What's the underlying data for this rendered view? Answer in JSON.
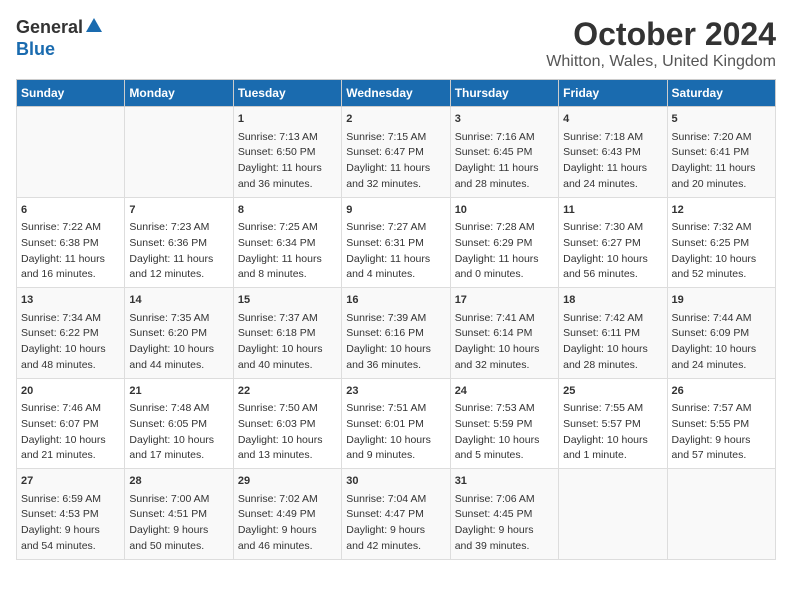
{
  "logo": {
    "general": "General",
    "blue": "Blue"
  },
  "title": {
    "month": "October 2024",
    "location": "Whitton, Wales, United Kingdom"
  },
  "days_of_week": [
    "Sunday",
    "Monday",
    "Tuesday",
    "Wednesday",
    "Thursday",
    "Friday",
    "Saturday"
  ],
  "weeks": [
    [
      {
        "day": "",
        "content": ""
      },
      {
        "day": "",
        "content": ""
      },
      {
        "day": "1",
        "content": "Sunrise: 7:13 AM\nSunset: 6:50 PM\nDaylight: 11 hours\nand 36 minutes."
      },
      {
        "day": "2",
        "content": "Sunrise: 7:15 AM\nSunset: 6:47 PM\nDaylight: 11 hours\nand 32 minutes."
      },
      {
        "day": "3",
        "content": "Sunrise: 7:16 AM\nSunset: 6:45 PM\nDaylight: 11 hours\nand 28 minutes."
      },
      {
        "day": "4",
        "content": "Sunrise: 7:18 AM\nSunset: 6:43 PM\nDaylight: 11 hours\nand 24 minutes."
      },
      {
        "day": "5",
        "content": "Sunrise: 7:20 AM\nSunset: 6:41 PM\nDaylight: 11 hours\nand 20 minutes."
      }
    ],
    [
      {
        "day": "6",
        "content": "Sunrise: 7:22 AM\nSunset: 6:38 PM\nDaylight: 11 hours\nand 16 minutes."
      },
      {
        "day": "7",
        "content": "Sunrise: 7:23 AM\nSunset: 6:36 PM\nDaylight: 11 hours\nand 12 minutes."
      },
      {
        "day": "8",
        "content": "Sunrise: 7:25 AM\nSunset: 6:34 PM\nDaylight: 11 hours\nand 8 minutes."
      },
      {
        "day": "9",
        "content": "Sunrise: 7:27 AM\nSunset: 6:31 PM\nDaylight: 11 hours\nand 4 minutes."
      },
      {
        "day": "10",
        "content": "Sunrise: 7:28 AM\nSunset: 6:29 PM\nDaylight: 11 hours\nand 0 minutes."
      },
      {
        "day": "11",
        "content": "Sunrise: 7:30 AM\nSunset: 6:27 PM\nDaylight: 10 hours\nand 56 minutes."
      },
      {
        "day": "12",
        "content": "Sunrise: 7:32 AM\nSunset: 6:25 PM\nDaylight: 10 hours\nand 52 minutes."
      }
    ],
    [
      {
        "day": "13",
        "content": "Sunrise: 7:34 AM\nSunset: 6:22 PM\nDaylight: 10 hours\nand 48 minutes."
      },
      {
        "day": "14",
        "content": "Sunrise: 7:35 AM\nSunset: 6:20 PM\nDaylight: 10 hours\nand 44 minutes."
      },
      {
        "day": "15",
        "content": "Sunrise: 7:37 AM\nSunset: 6:18 PM\nDaylight: 10 hours\nand 40 minutes."
      },
      {
        "day": "16",
        "content": "Sunrise: 7:39 AM\nSunset: 6:16 PM\nDaylight: 10 hours\nand 36 minutes."
      },
      {
        "day": "17",
        "content": "Sunrise: 7:41 AM\nSunset: 6:14 PM\nDaylight: 10 hours\nand 32 minutes."
      },
      {
        "day": "18",
        "content": "Sunrise: 7:42 AM\nSunset: 6:11 PM\nDaylight: 10 hours\nand 28 minutes."
      },
      {
        "day": "19",
        "content": "Sunrise: 7:44 AM\nSunset: 6:09 PM\nDaylight: 10 hours\nand 24 minutes."
      }
    ],
    [
      {
        "day": "20",
        "content": "Sunrise: 7:46 AM\nSunset: 6:07 PM\nDaylight: 10 hours\nand 21 minutes."
      },
      {
        "day": "21",
        "content": "Sunrise: 7:48 AM\nSunset: 6:05 PM\nDaylight: 10 hours\nand 17 minutes."
      },
      {
        "day": "22",
        "content": "Sunrise: 7:50 AM\nSunset: 6:03 PM\nDaylight: 10 hours\nand 13 minutes."
      },
      {
        "day": "23",
        "content": "Sunrise: 7:51 AM\nSunset: 6:01 PM\nDaylight: 10 hours\nand 9 minutes."
      },
      {
        "day": "24",
        "content": "Sunrise: 7:53 AM\nSunset: 5:59 PM\nDaylight: 10 hours\nand 5 minutes."
      },
      {
        "day": "25",
        "content": "Sunrise: 7:55 AM\nSunset: 5:57 PM\nDaylight: 10 hours\nand 1 minute."
      },
      {
        "day": "26",
        "content": "Sunrise: 7:57 AM\nSunset: 5:55 PM\nDaylight: 9 hours\nand 57 minutes."
      }
    ],
    [
      {
        "day": "27",
        "content": "Sunrise: 6:59 AM\nSunset: 4:53 PM\nDaylight: 9 hours\nand 54 minutes."
      },
      {
        "day": "28",
        "content": "Sunrise: 7:00 AM\nSunset: 4:51 PM\nDaylight: 9 hours\nand 50 minutes."
      },
      {
        "day": "29",
        "content": "Sunrise: 7:02 AM\nSunset: 4:49 PM\nDaylight: 9 hours\nand 46 minutes."
      },
      {
        "day": "30",
        "content": "Sunrise: 7:04 AM\nSunset: 4:47 PM\nDaylight: 9 hours\nand 42 minutes."
      },
      {
        "day": "31",
        "content": "Sunrise: 7:06 AM\nSunset: 4:45 PM\nDaylight: 9 hours\nand 39 minutes."
      },
      {
        "day": "",
        "content": ""
      },
      {
        "day": "",
        "content": ""
      }
    ]
  ]
}
